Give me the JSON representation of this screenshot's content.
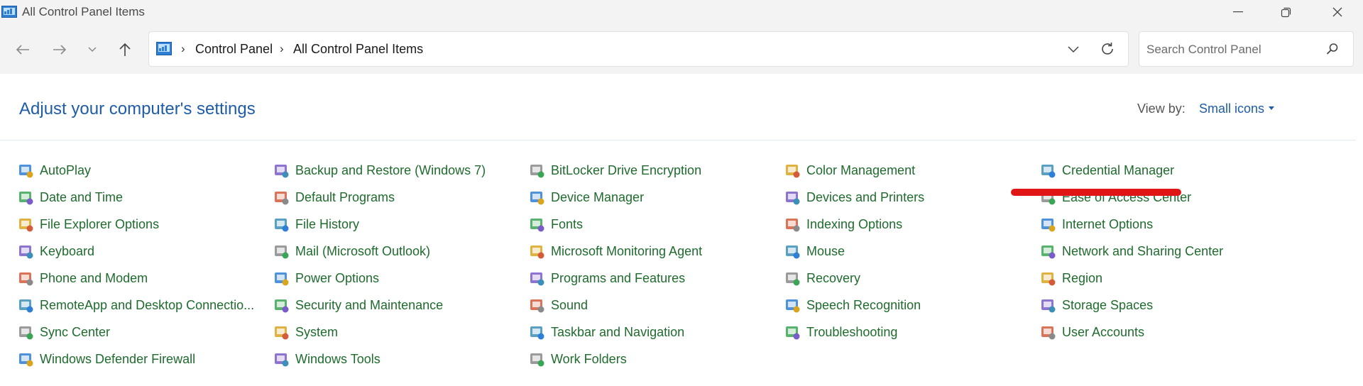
{
  "window": {
    "title": "All Control Panel Items",
    "icon": "control-panel-icon",
    "controls": [
      "minimize-icon",
      "restore-icon",
      "close-icon"
    ]
  },
  "navigation": {
    "buttons": [
      "back-arrow-icon",
      "forward-arrow-icon",
      "recent-locations-chevron-icon",
      "up-arrow-icon"
    ],
    "breadcrumb": [
      "Control Panel",
      "All Control Panel Items"
    ],
    "separator": "›",
    "search": {
      "placeholder": "Search Control Panel",
      "value": ""
    }
  },
  "header": {
    "title": "Adjust your computer's settings",
    "view_by_label": "View by:",
    "view_by_value": "Small icons"
  },
  "items": [
    [
      "AutoPlay",
      "Date and Time",
      "File Explorer Options",
      "Keyboard",
      "Phone and Modem",
      "RemoteApp and Desktop Connectio...",
      "Sync Center",
      "Windows Defender Firewall"
    ],
    [
      "Backup and Restore (Windows 7)",
      "Default Programs",
      "File History",
      "Mail (Microsoft Outlook)",
      "Power Options",
      "Security and Maintenance",
      "System",
      "Windows Tools"
    ],
    [
      "BitLocker Drive Encryption",
      "Device Manager",
      "Fonts",
      "Microsoft Monitoring Agent",
      "Programs and Features",
      "Sound",
      "Taskbar and Navigation",
      "Work Folders"
    ],
    [
      "Color Management",
      "Devices and Printers",
      "Indexing Options",
      "Mouse",
      "Recovery",
      "Speech Recognition",
      "Troubleshooting"
    ],
    [
      "Credential Manager",
      "Ease of Access Center",
      "Internet Options",
      "Network and Sharing Center",
      "Region",
      "Storage Spaces",
      "User Accounts"
    ]
  ],
  "colors": {
    "link_green": "#1f6b2e",
    "heading_blue": "#1f5ca8",
    "annotation_red": "#e01616",
    "chrome_bg": "#f3f3f3"
  },
  "annotation": {
    "marked_item": "Credential Manager"
  }
}
